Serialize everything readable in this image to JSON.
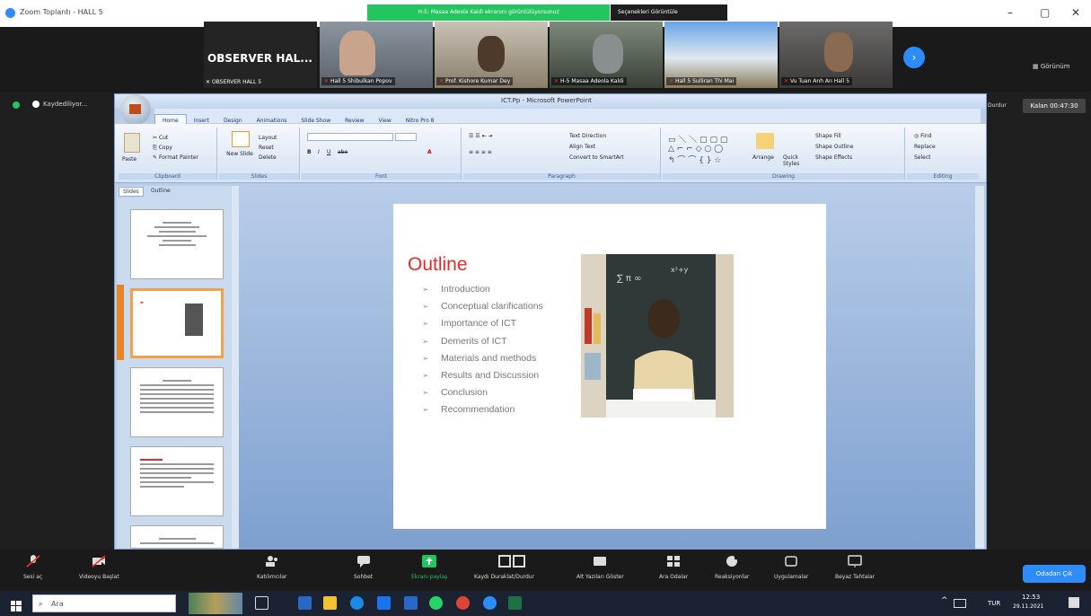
{
  "zoom": {
    "window_title": "Zoom Toplantı - HALL 5",
    "share_banner": "H-5: Masaa Adeola Kaldi ekranını görüntülüyorsunuz",
    "view_options": "Seçenekleri Görüntüle",
    "view_label": "Görünüm",
    "recording_label": "Kaydediliyor...",
    "stop_label": "Durdur",
    "timer": "Kalan 00:47:30",
    "participants": [
      {
        "name": "OBSERVER HAL...",
        "caption": "OBSERVER HALL 5"
      },
      {
        "caption": "Hall 5 Shibulkan Popov"
      },
      {
        "caption": "Prof. Kishore Kumar Dey"
      },
      {
        "caption": "H-5 Masaa Adeola Kaldi"
      },
      {
        "caption": "Hall 5 Sulliran Thi Mai"
      },
      {
        "caption": "Vu Tuan Anh An Hall 5"
      }
    ],
    "controls": [
      {
        "label": "Sesi aç",
        "icon": "microphone-icon"
      },
      {
        "label": "Videoyu Başlat",
        "icon": "video-icon"
      },
      {
        "label": "Katılımcılar",
        "icon": "participants-icon"
      },
      {
        "label": "Sohbet",
        "icon": "chat-icon"
      },
      {
        "label": "Ekranı paylaş",
        "icon": "share-screen-icon"
      },
      {
        "label": "Kaydı Duraklat/Durdur",
        "icon": "record-icon"
      },
      {
        "label": "Alt Yazıları Göster",
        "icon": "captions-icon"
      },
      {
        "label": "Ara Odalar",
        "icon": "breakout-icon"
      },
      {
        "label": "Reaksiyonlar",
        "icon": "reactions-icon"
      },
      {
        "label": "Uygulamalar",
        "icon": "apps-icon"
      },
      {
        "label": "Beyaz Tahtalar",
        "icon": "whiteboard-icon"
      }
    ],
    "end_button": "Odadan Çık"
  },
  "powerpoint": {
    "title": "ICT.Pp - Microsoft PowerPoint",
    "tabs": [
      "Home",
      "Insert",
      "Design",
      "Animations",
      "Slide Show",
      "Review",
      "View",
      "Nitro Pro 8"
    ],
    "ribbon": {
      "clipboard": {
        "label": "Clipboard",
        "paste": "Paste",
        "cut": "Cut",
        "copy": "Copy",
        "format_painter": "Format Painter"
      },
      "slides": {
        "label": "Slides",
        "new_slide": "New Slide",
        "layout": "Layout",
        "reset": "Reset",
        "delete": "Delete"
      },
      "font": {
        "label": "Font"
      },
      "paragraph": {
        "label": "Paragraph",
        "text_direction": "Text Direction",
        "align_text": "Align Text",
        "smartart": "Convert to SmartArt"
      },
      "drawing": {
        "label": "Drawing",
        "arrange": "Arrange",
        "quick_styles": "Quick Styles",
        "shape_fill": "Shape Fill",
        "shape_outline": "Shape Outline",
        "shape_effects": "Shape Effects"
      },
      "editing": {
        "label": "Editing",
        "find": "Find",
        "replace": "Replace",
        "select": "Select"
      }
    },
    "panel_tabs": [
      "Slides",
      "Outline"
    ],
    "slide": {
      "title": "Outline",
      "bullets": [
        "Introduction",
        "Conceptual clarifications",
        "Importance of ICT",
        "Demerits of ICT",
        "Materials and methods",
        "Results and Discussion",
        "Conclusion",
        "Recommendation"
      ],
      "bullet_marker": "➢"
    }
  },
  "taskbar": {
    "search_placeholder": "Ara",
    "tray_lang": "TUR",
    "time": "12:53",
    "date": "29.11.2021"
  },
  "colors": {
    "zoom_accent": "#2d8cff",
    "share_green": "#23c55e",
    "slide_title_red": "#e32b2b"
  }
}
